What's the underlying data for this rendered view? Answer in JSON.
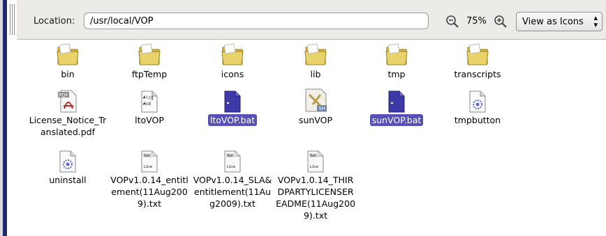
{
  "toolbar": {
    "location_label": "Location:",
    "location_value": "/usr/local/VOP",
    "zoom_level": "75%",
    "view_mode": "View as Icons"
  },
  "files": [
    {
      "label": "bin",
      "type": "folder",
      "selected": false
    },
    {
      "label": "ftpTemp",
      "type": "folder",
      "selected": false
    },
    {
      "label": "icons",
      "type": "folder",
      "selected": false
    },
    {
      "label": "lib",
      "type": "folder",
      "selected": false
    },
    {
      "label": "tmp",
      "type": "folder",
      "selected": false
    },
    {
      "label": "transcripts",
      "type": "folder",
      "selected": false
    },
    {
      "label": "License_Notice_Translated.pdf",
      "type": "pdf",
      "selected": false
    },
    {
      "label": "ltoVOP",
      "type": "script",
      "selected": false
    },
    {
      "label": "ltoVOP.bat",
      "type": "bat",
      "selected": true
    },
    {
      "label": "sunVOP",
      "type": "shell",
      "selected": false
    },
    {
      "label": "sunVOP.bat",
      "type": "bat",
      "selected": true
    },
    {
      "label": "tmpbutton",
      "type": "binary",
      "selected": false
    },
    {
      "label": "uninstall",
      "type": "binary",
      "selected": false
    },
    {
      "label": "VOPv1.0.14_entitlement(11Aug2009).txt",
      "type": "text",
      "selected": false
    },
    {
      "label": "VOPv1.0.14_SLA&entitlement(11Aug2009).txt",
      "type": "text",
      "selected": false
    },
    {
      "label": "VOPv1.0.14_THIRDPARTYLICENSEREADME(11Aug2009).txt",
      "type": "text",
      "selected": false
    }
  ],
  "icon_text": {
    "pdf": "PDF",
    "script": "#!/g",
    "sh": "SH",
    "sun": "Sun",
    "doc": "DO"
  },
  "colors": {
    "selection": "#5650b8",
    "folder": "#e8d36a",
    "bat_icon": "#3d3aa8"
  }
}
